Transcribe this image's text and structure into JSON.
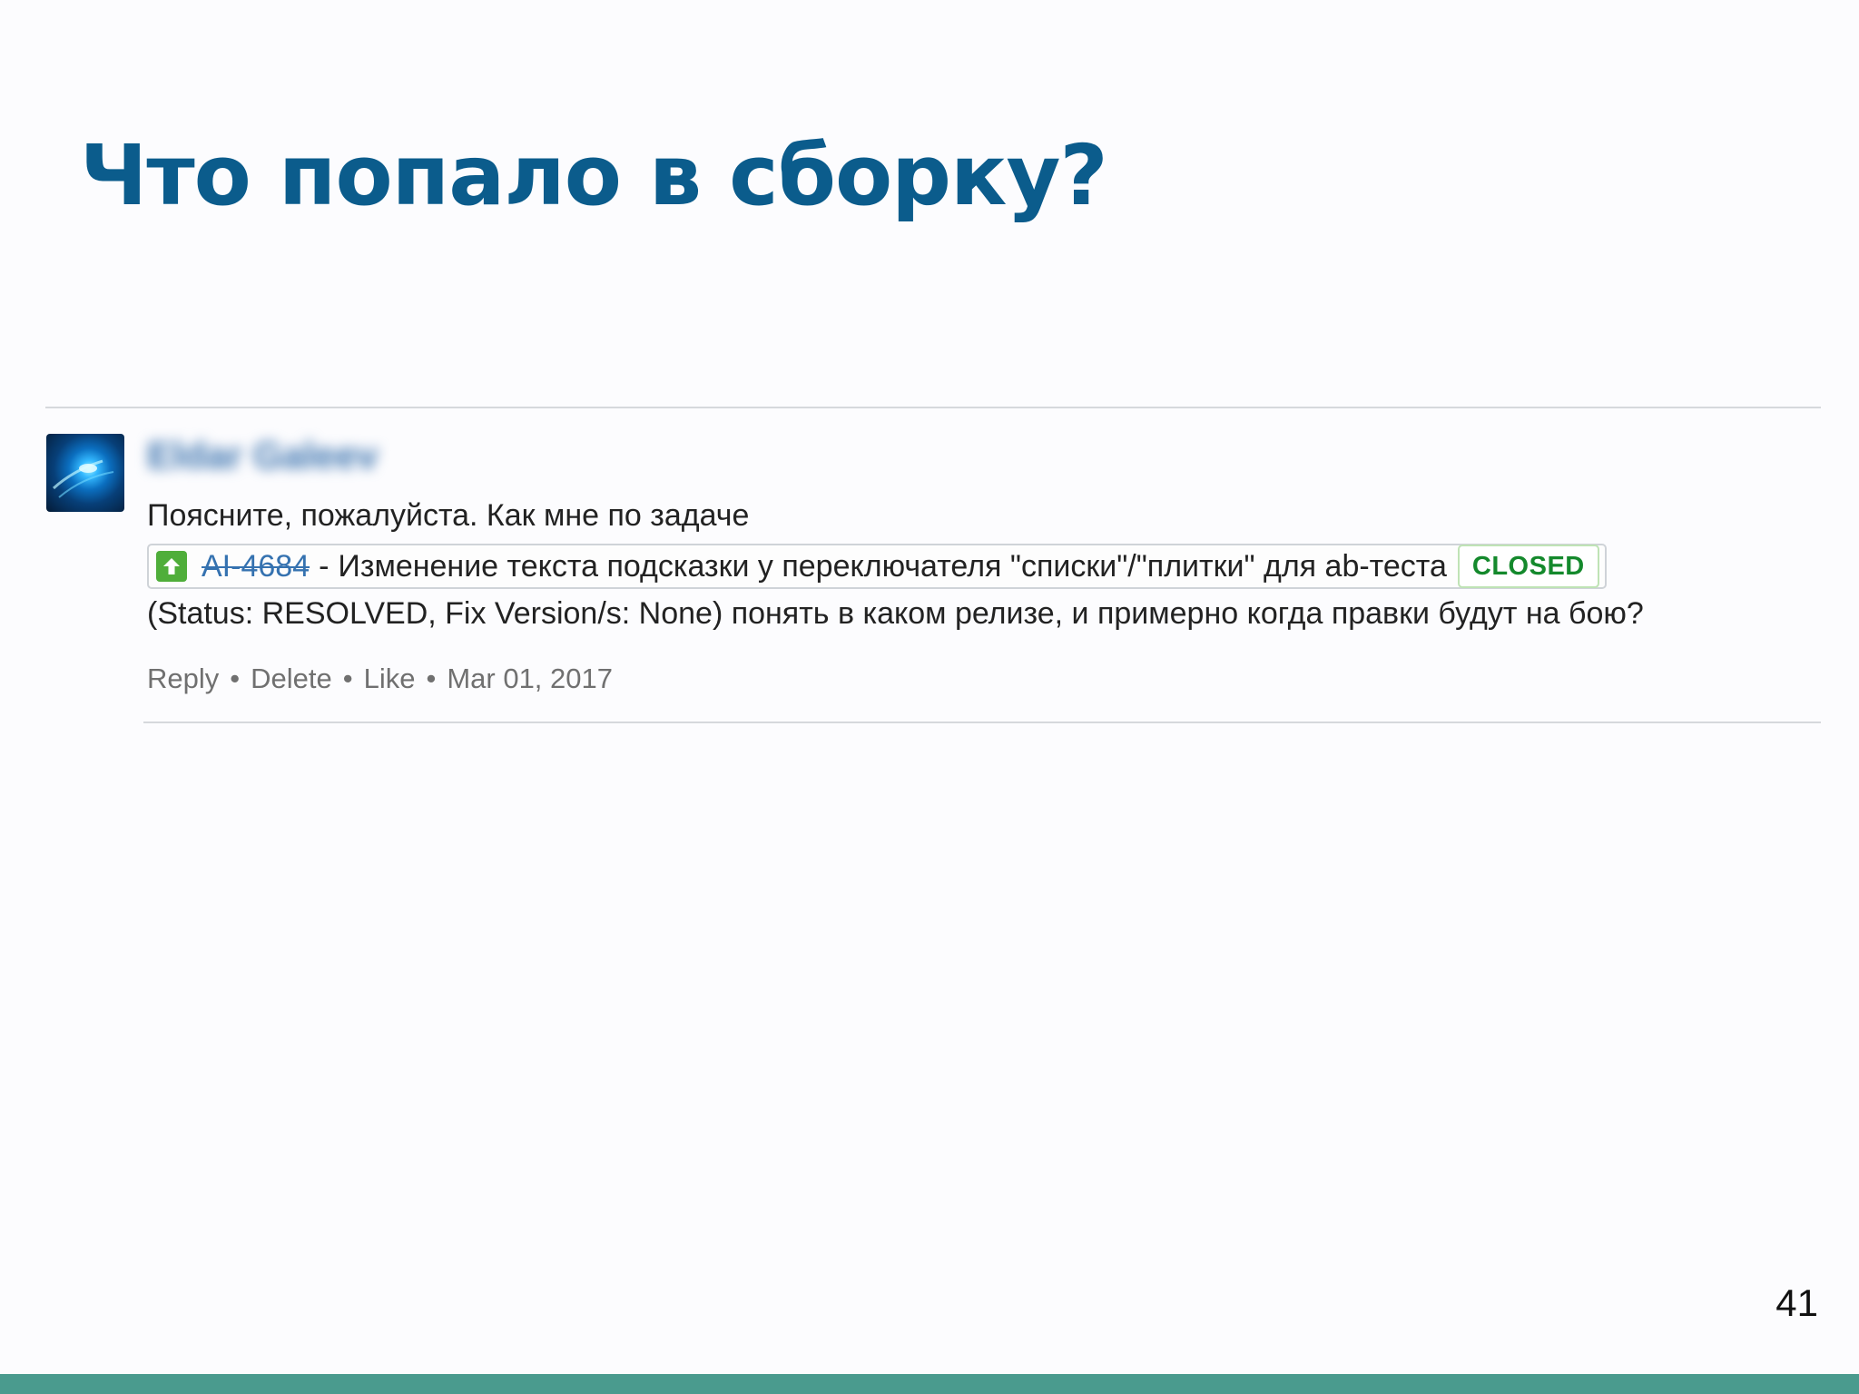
{
  "slide": {
    "title": "Что попало в сборку?",
    "page_number": "41"
  },
  "comment": {
    "author": "Eldar Galeev",
    "line1": "Поясните, пожалуйста. Как мне по задаче",
    "issue": {
      "key": "AI-4684",
      "separator": "-",
      "summary": "Изменение текста подсказки у переключателя \"списки\"/\"плитки\" для ab-теста",
      "status": "CLOSED",
      "type_icon": "arrow-up-icon"
    },
    "line3": "(Status: RESOLVED, Fix Version/s: None) понять в каком релизе, и примерно когда правки будут на бою?",
    "actions": {
      "reply": "Reply",
      "delete": "Delete",
      "like": "Like",
      "separator": "•",
      "date": "Mar 01, 2017"
    }
  },
  "colors": {
    "title": "#0b5c8c",
    "link": "#3572b0",
    "status_green": "#14892c",
    "footer_bar": "#4a9b8e"
  }
}
